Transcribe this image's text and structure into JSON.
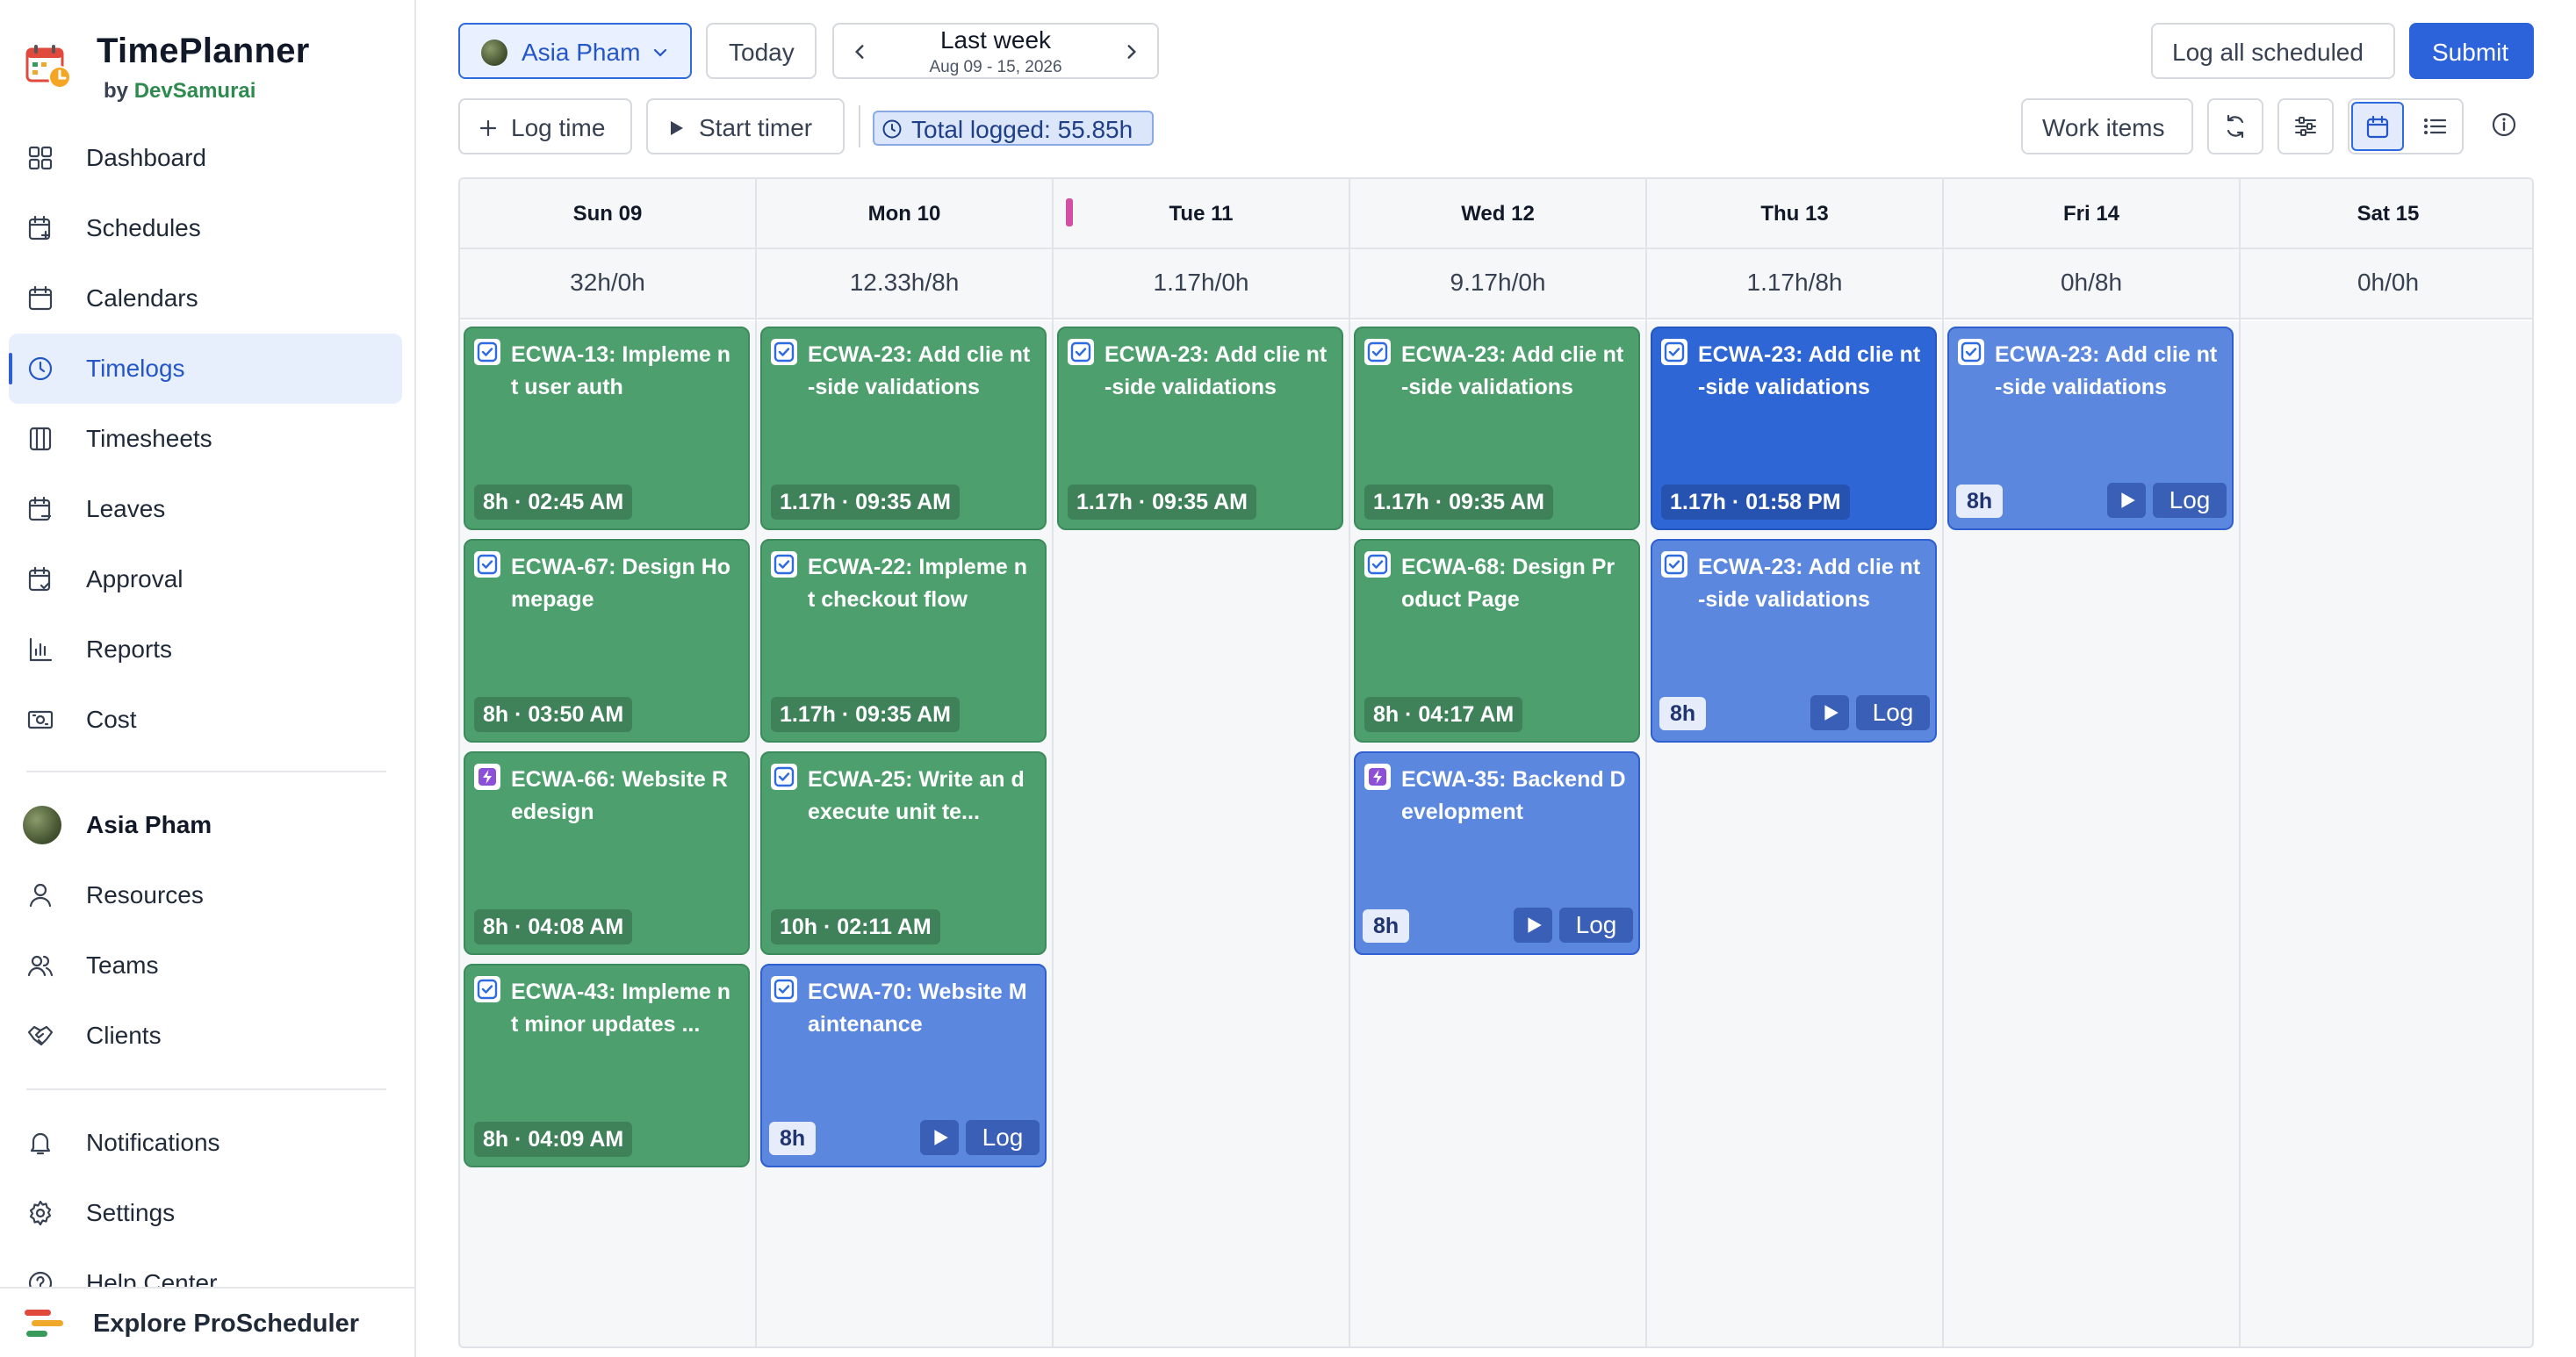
{
  "app": {
    "title": "TimePlanner",
    "by_prefix": "by",
    "by_brand": "DevSamurai"
  },
  "sidebar": {
    "items": [
      {
        "label": "Dashboard",
        "icon": "dashboard-icon"
      },
      {
        "label": "Schedules",
        "icon": "calendar-plus-icon"
      },
      {
        "label": "Calendars",
        "icon": "calendar-icon"
      },
      {
        "label": "Timelogs",
        "icon": "clock-icon",
        "active": true
      },
      {
        "label": "Timesheets",
        "icon": "columns-icon"
      },
      {
        "label": "Leaves",
        "icon": "calendar-minus-icon"
      },
      {
        "label": "Approval",
        "icon": "calendar-check-icon"
      },
      {
        "label": "Reports",
        "icon": "bar-chart-icon"
      },
      {
        "label": "Cost",
        "icon": "money-icon"
      }
    ],
    "user": {
      "name": "Asia Pham"
    },
    "people": [
      {
        "label": "Resources",
        "icon": "user-icon"
      },
      {
        "label": "Teams",
        "icon": "users-icon"
      },
      {
        "label": "Clients",
        "icon": "handshake-icon"
      }
    ],
    "system": [
      {
        "label": "Notifications",
        "icon": "bell-icon"
      },
      {
        "label": "Settings",
        "icon": "gear-icon"
      },
      {
        "label": "Help Center",
        "icon": "help-icon"
      }
    ],
    "explore": "Explore ProScheduler"
  },
  "toolbar": {
    "user_select": "Asia Pham",
    "today": "Today",
    "period": "Last week",
    "period_range": "Aug 09 - 15, 2026",
    "log_all": "Log all scheduled",
    "submit": "Submit",
    "log_time": "Log time",
    "start_timer": "Start timer",
    "total_logged": "Total logged: 55.85h",
    "work_items": "Work items"
  },
  "colors": {
    "accent": "#2d63da",
    "logged": "#4e9f6e",
    "scheduled": "#5b87de",
    "today_marker": "#d14fa4"
  },
  "calendar": {
    "days": [
      {
        "label": "Sun 09",
        "summary": "32h/0h",
        "cards": [
          {
            "title": "ECWA-13: Impleme nt user auth",
            "meta": "8h · 02:45 AM",
            "type": "logged",
            "icon": "checkbox-icon"
          },
          {
            "title": "ECWA-67: Design Homepage",
            "meta": "8h · 03:50 AM",
            "type": "logged",
            "icon": "checkbox-icon"
          },
          {
            "title": "ECWA-66: Website Redesign",
            "meta": "8h · 04:08 AM",
            "type": "logged",
            "icon": "epic-icon"
          },
          {
            "title": "ECWA-43: Impleme nt minor updates ...",
            "meta": "8h · 04:09 AM",
            "type": "logged",
            "icon": "checkbox-icon"
          }
        ]
      },
      {
        "label": "Mon 10",
        "summary": "12.33h/8h",
        "cards": [
          {
            "title": "ECWA-23: Add clie nt-side validations",
            "meta": "1.17h · 09:35 AM",
            "type": "logged",
            "icon": "checkbox-icon"
          },
          {
            "title": "ECWA-22: Impleme nt checkout flow",
            "meta": "1.17h · 09:35 AM",
            "type": "logged",
            "icon": "checkbox-icon"
          },
          {
            "title": "ECWA-25: Write an d execute unit te...",
            "meta": "10h · 02:11 AM",
            "type": "logged",
            "icon": "checkbox-icon"
          },
          {
            "title": "ECWA-70: Website Maintenance",
            "hours": "8h",
            "log": "Log",
            "type": "scheduled",
            "icon": "checkbox-icon"
          }
        ]
      },
      {
        "label": "Tue 11",
        "summary": "1.17h/0h",
        "today": true,
        "cards": [
          {
            "title": "ECWA-23: Add clie nt-side validations",
            "meta": "1.17h · 09:35 AM",
            "type": "logged",
            "icon": "checkbox-icon"
          }
        ]
      },
      {
        "label": "Wed 12",
        "summary": "9.17h/0h",
        "cards": [
          {
            "title": "ECWA-23: Add clie nt-side validations",
            "meta": "1.17h · 09:35 AM",
            "type": "logged",
            "icon": "checkbox-icon"
          },
          {
            "title": "ECWA-68: Design Product Page",
            "meta": "8h · 04:17 AM",
            "type": "logged",
            "icon": "checkbox-icon"
          },
          {
            "title": "ECWA-35: Backend Development",
            "hours": "8h",
            "log": "Log",
            "type": "scheduled",
            "icon": "epic-icon"
          }
        ]
      },
      {
        "label": "Thu 13",
        "summary": "1.17h/8h",
        "cards": [
          {
            "title": "ECWA-23: Add clie nt-side validations",
            "meta": "1.17h · 01:58 PM",
            "type": "logged-blue",
            "icon": "checkbox-icon"
          },
          {
            "title": "ECWA-23: Add clie nt-side validations",
            "hours": "8h",
            "log": "Log",
            "type": "scheduled",
            "icon": "checkbox-icon"
          }
        ]
      },
      {
        "label": "Fri 14",
        "summary": "0h/8h",
        "cards": [
          {
            "title": "ECWA-23: Add clie nt-side validations",
            "hours": "8h",
            "log": "Log",
            "type": "scheduled",
            "icon": "checkbox-icon"
          }
        ]
      },
      {
        "label": "Sat 15",
        "summary": "0h/0h",
        "cards": []
      }
    ]
  }
}
